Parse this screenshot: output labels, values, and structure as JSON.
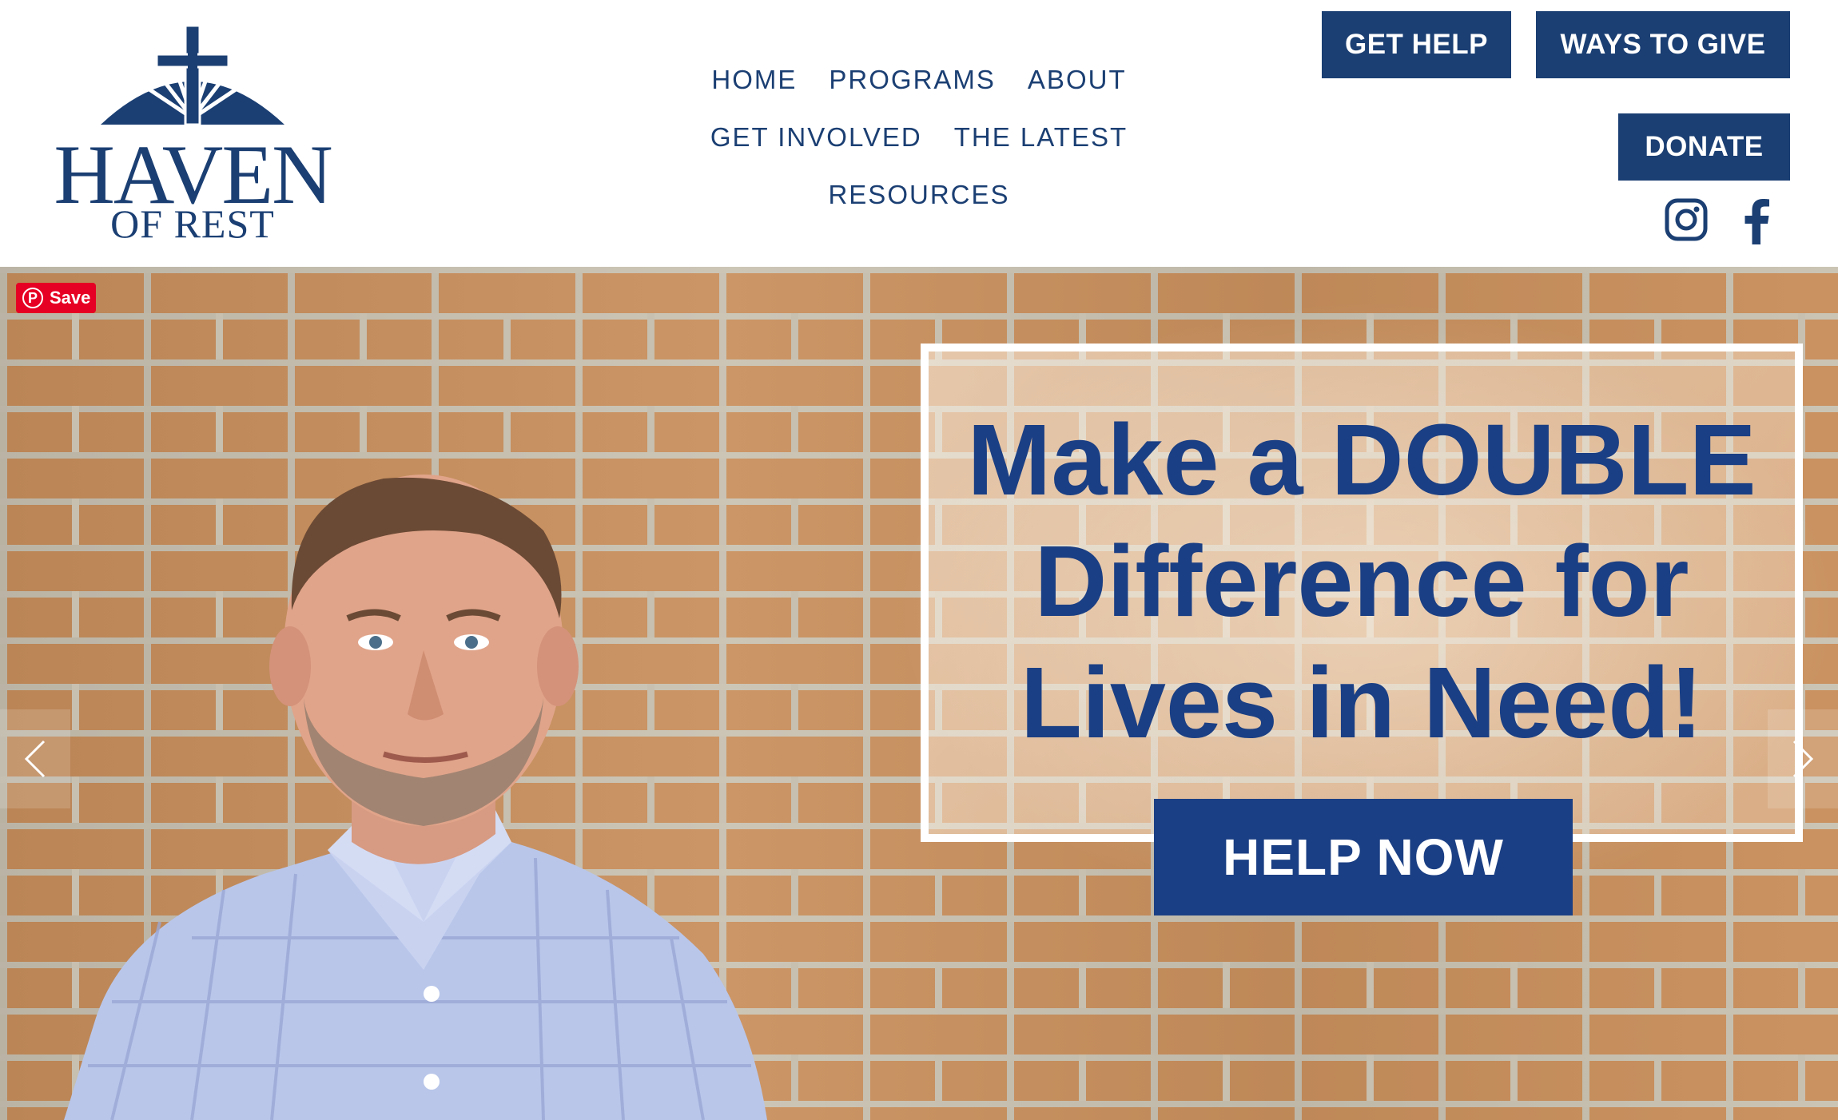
{
  "logo": {
    "main": "HAVEN",
    "sub": "OF REST"
  },
  "nav": {
    "rows": [
      [
        "HOME",
        "PROGRAMS",
        "ABOUT"
      ],
      [
        "GET INVOLVED",
        "THE LATEST"
      ],
      [
        "RESOURCES"
      ]
    ]
  },
  "header_buttons": {
    "get_help": "GET HELP",
    "ways_to_give": "WAYS TO GIVE",
    "donate": "DONATE"
  },
  "social": {
    "instagram": "instagram-icon",
    "facebook": "facebook-icon"
  },
  "hero": {
    "pin_save": "Save",
    "headline_lines": [
      "Make a DOUBLE",
      "Difference for",
      "Lives in Need!"
    ],
    "cta": "HELP NOW"
  },
  "colors": {
    "brand_navy": "#1b3f73",
    "hero_navy": "#1b3f84",
    "pinterest_red": "#e60023"
  }
}
